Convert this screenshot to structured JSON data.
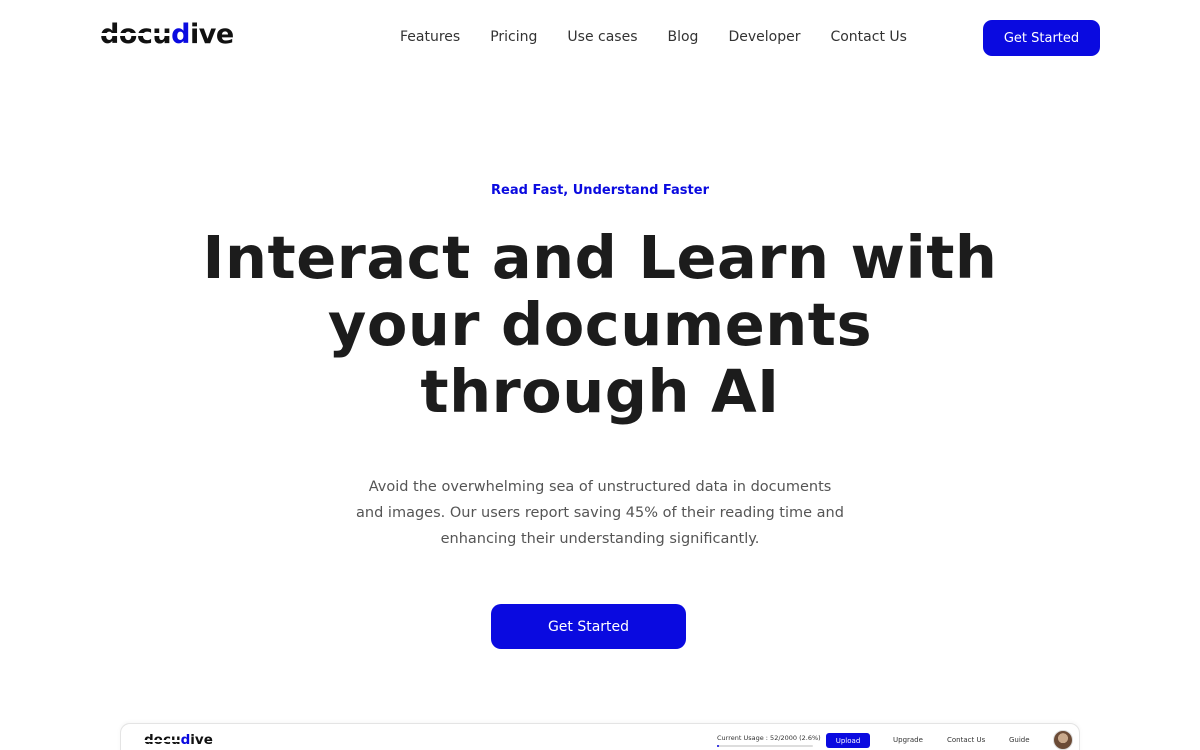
{
  "header": {
    "logo": {
      "part1": "docu",
      "part2": "dive"
    },
    "nav": [
      "Features",
      "Pricing",
      "Use cases",
      "Blog",
      "Developer",
      "Contact Us"
    ],
    "cta_label": "Get Started"
  },
  "hero": {
    "eyebrow": "Read Fast, Understand Faster",
    "title": "Interact and Learn with your documents through AI",
    "description": "Avoid the overwhelming sea of unstructured data in documents and images. Our users report saving 45% of their reading time and enhancing their understanding significantly.",
    "cta_label": "Get Started"
  },
  "preview": {
    "logo": {
      "part1": "docu",
      "part2": "dive"
    },
    "usage_text": "Current Usage : 52/2000 (2.6%)",
    "usage_fraction": 0.026,
    "upload_label": "Upload",
    "nav": [
      "Upgrade",
      "Contact Us",
      "Guide"
    ]
  },
  "colors": {
    "accent": "#0a0ae0",
    "text": "#1c1c1c"
  }
}
